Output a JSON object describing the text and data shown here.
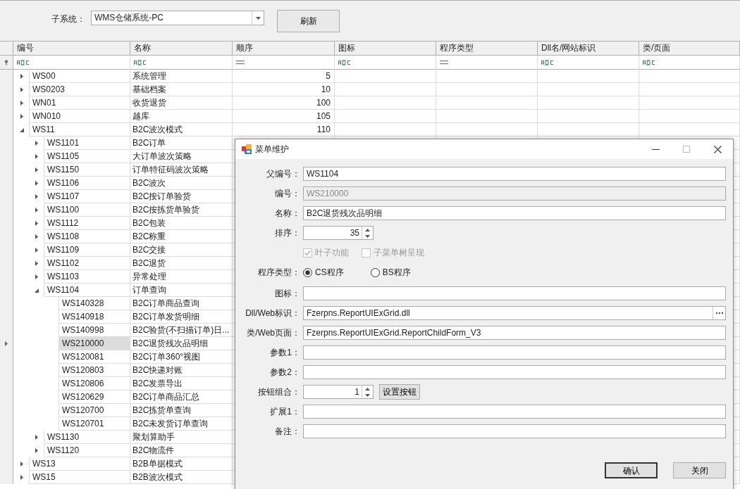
{
  "toolbar": {
    "subsystem_label": "子系统：",
    "subsystem_value": "WMS仓储系统-PC",
    "refresh_button": "刷新"
  },
  "grid": {
    "columns": [
      {
        "label": "编号",
        "kind": "text"
      },
      {
        "label": "名称",
        "kind": "text"
      },
      {
        "label": "顺序",
        "kind": "number"
      },
      {
        "label": "图标",
        "kind": "text"
      },
      {
        "label": "程序类型",
        "kind": "number"
      },
      {
        "label": "Dll名/网站标识",
        "kind": "text"
      },
      {
        "label": "类/页面",
        "kind": "text"
      }
    ],
    "rows": [
      {
        "code": "WS00",
        "name": "系统管理",
        "order": "5",
        "expanded": false,
        "selected": false
      },
      {
        "code": "WS0203",
        "name": "基础档案",
        "order": "10",
        "expanded": false,
        "selected": false
      },
      {
        "code": "WN01",
        "name": "收货退货",
        "order": "100",
        "expanded": false,
        "selected": false
      },
      {
        "code": "WN010",
        "name": "越库",
        "order": "105",
        "expanded": false,
        "selected": false
      },
      {
        "code": "WS11",
        "name": "B2C波次模式",
        "order": "110",
        "expanded": true,
        "selected": false,
        "children": [
          {
            "code": "WS1101",
            "name": "B2C订单",
            "expanded": false,
            "selected": false
          },
          {
            "code": "WS1105",
            "name": "大订单波次策略",
            "expanded": false,
            "selected": false
          },
          {
            "code": "WS1150",
            "name": "订单特征码波次策略",
            "expanded": false,
            "selected": false
          },
          {
            "code": "WS1106",
            "name": "B2C波次",
            "expanded": false,
            "selected": false
          },
          {
            "code": "WS1107",
            "name": "B2C按订单验货",
            "expanded": false,
            "selected": false
          },
          {
            "code": "WS1100",
            "name": "B2C按拣货单验货",
            "expanded": false,
            "selected": false
          },
          {
            "code": "WS1112",
            "name": "B2C包装",
            "expanded": false,
            "selected": false
          },
          {
            "code": "WS1108",
            "name": "B2C称重",
            "expanded": false,
            "selected": false
          },
          {
            "code": "WS1109",
            "name": "B2C交接",
            "expanded": false,
            "selected": false
          },
          {
            "code": "WS1102",
            "name": "B2C退货",
            "expanded": false,
            "selected": false
          },
          {
            "code": "WS1103",
            "name": "异常处理",
            "expanded": false,
            "selected": false
          },
          {
            "code": "WS1104",
            "name": "订单查询",
            "expanded": true,
            "selected": false,
            "children": [
              {
                "code": "WS140328",
                "name": "B2C订单商品查询",
                "selected": false
              },
              {
                "code": "WS140918",
                "name": "B2C订单发货明细",
                "selected": false
              },
              {
                "code": "WS140998",
                "name": "B2C验货(不扫描订单)日...",
                "selected": false
              },
              {
                "code": "WS210000",
                "name": "B2C退货残次品明细",
                "selected": true
              },
              {
                "code": "WS120081",
                "name": "B2C订单360°视图",
                "selected": false
              },
              {
                "code": "WS120803",
                "name": "B2C快递对账",
                "selected": false
              },
              {
                "code": "WS120806",
                "name": "B2C发票导出",
                "selected": false
              },
              {
                "code": "WS120629",
                "name": "B2C订单商品汇总",
                "selected": false
              },
              {
                "code": "WS120700",
                "name": "B2C拣货单查询",
                "selected": false
              },
              {
                "code": "WS120701",
                "name": "B2C未发货订单查询",
                "selected": false
              }
            ]
          },
          {
            "code": "WS1130",
            "name": "聚划算助手",
            "expanded": false,
            "selected": false
          },
          {
            "code": "WS1120",
            "name": "B2C物流件",
            "expanded": false,
            "selected": false
          }
        ]
      },
      {
        "code": "WS13",
        "name": "B2B单据模式",
        "expanded": false,
        "selected": false
      },
      {
        "code": "WS15",
        "name": "B2B波次模式",
        "expanded": false,
        "selected": false
      }
    ]
  },
  "dialog": {
    "title": "菜单维护",
    "fields": [
      {
        "kind": "text",
        "label": "父编号：",
        "value": "WS1104",
        "disabled": false
      },
      {
        "kind": "text",
        "label": "编号：",
        "value": "WS210000",
        "disabled": true
      },
      {
        "kind": "text",
        "label": "名称：",
        "value": "B2C退货残次品明细",
        "disabled": false
      },
      {
        "kind": "spin",
        "label": "排序：",
        "value": "35"
      },
      {
        "kind": "checks",
        "options": [
          {
            "label": "叶子功能",
            "checked": true,
            "disabled": true
          },
          {
            "label": "子菜单树呈现",
            "checked": false,
            "disabled": true
          }
        ]
      },
      {
        "kind": "radios",
        "label": "程序类型：",
        "options": [
          {
            "label": "CS程序",
            "selected": true
          },
          {
            "label": "BS程序",
            "selected": false
          }
        ]
      },
      {
        "kind": "text",
        "label": "图标：",
        "disabled": false
      },
      {
        "kind": "browse",
        "label": "Dll/Web标识：",
        "value": "Fzerpns.ReportUIExGrid.dll"
      },
      {
        "kind": "text",
        "label": "类/Web页面：",
        "value": "Fzerpns.ReportUIExGrid.ReportChildForm_V3",
        "disabled": false
      },
      {
        "kind": "text",
        "label": "参数1：",
        "disabled": false
      },
      {
        "kind": "text",
        "label": "参数2：",
        "disabled": false
      },
      {
        "kind": "spin",
        "label": "按钮组合：",
        "value": "1",
        "button": "设置按钮"
      },
      {
        "kind": "text",
        "label": "扩展1：",
        "disabled": false
      },
      {
        "kind": "text",
        "label": "备注：",
        "disabled": false
      }
    ],
    "buttons": [
      {
        "label": "确认",
        "default": true
      },
      {
        "label": "关闭",
        "default": false
      }
    ]
  }
}
